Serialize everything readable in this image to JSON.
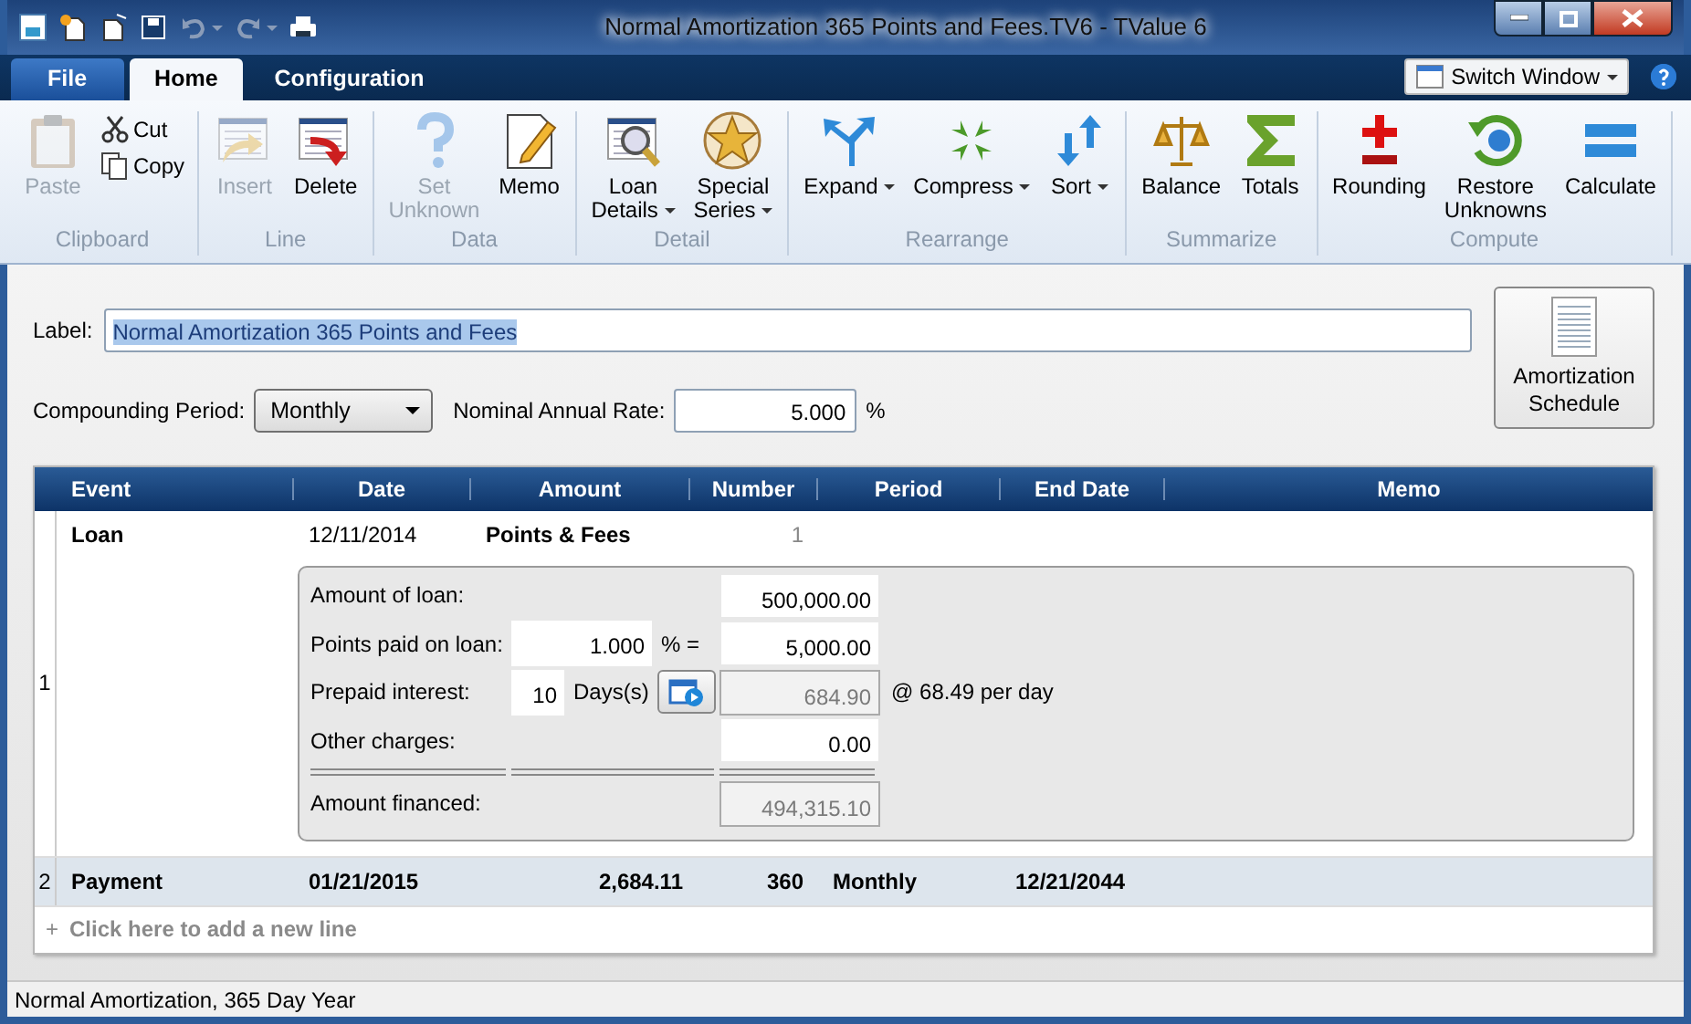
{
  "window": {
    "title": "Normal Amortization 365 Points and Fees.TV6 - TValue 6"
  },
  "menu_tabs": [
    {
      "label": "File",
      "kind": "application",
      "selected": false
    },
    {
      "label": "Home",
      "kind": "tab",
      "selected": true
    },
    {
      "label": "Configuration",
      "kind": "tab",
      "selected": false
    }
  ],
  "switch_window": {
    "label": "Switch Window"
  },
  "ribbon": [
    {
      "label": "Clipboard",
      "items": [
        {
          "label": "Paste",
          "kind": "large",
          "disabled": true,
          "dropdown": false
        },
        {
          "label": "Cut",
          "kind": "small",
          "disabled": false
        },
        {
          "label": "Copy",
          "kind": "small",
          "disabled": false
        }
      ]
    },
    {
      "label": "Line",
      "items": [
        {
          "label": "Insert",
          "kind": "large",
          "disabled": true,
          "dropdown": false
        },
        {
          "label": "Delete",
          "kind": "large",
          "disabled": false,
          "dropdown": false
        }
      ]
    },
    {
      "label": "Data",
      "items": [
        {
          "label": "Set Unknown",
          "kind": "large",
          "disabled": true,
          "dropdown": false
        },
        {
          "label": "Memo",
          "kind": "large",
          "disabled": false,
          "dropdown": false
        }
      ]
    },
    {
      "label": "Detail",
      "items": [
        {
          "label": "Loan Details",
          "kind": "large",
          "disabled": false,
          "dropdown": true
        },
        {
          "label": "Special Series",
          "kind": "large",
          "disabled": false,
          "dropdown": true
        }
      ]
    },
    {
      "label": "Rearrange",
      "items": [
        {
          "label": "Expand",
          "kind": "large",
          "disabled": false,
          "dropdown": true
        },
        {
          "label": "Compress",
          "kind": "large",
          "disabled": false,
          "dropdown": true
        },
        {
          "label": "Sort",
          "kind": "large",
          "disabled": false,
          "dropdown": true
        }
      ]
    },
    {
      "label": "Summarize",
      "items": [
        {
          "label": "Balance",
          "kind": "large",
          "disabled": false,
          "dropdown": false
        },
        {
          "label": "Totals",
          "kind": "large",
          "disabled": false,
          "dropdown": false
        }
      ]
    },
    {
      "label": "Compute",
      "items": [
        {
          "label": "Rounding",
          "kind": "large",
          "disabled": false,
          "dropdown": false
        },
        {
          "label": "Restore Unknowns",
          "kind": "large",
          "disabled": false,
          "dropdown": false
        },
        {
          "label": "Calculate",
          "kind": "large",
          "disabled": false,
          "dropdown": false
        }
      ]
    }
  ],
  "form": {
    "label_field": {
      "label": "Label:",
      "value": "Normal Amortization 365 Points and Fees",
      "text_selected": true
    },
    "compounding": {
      "label": "Compounding Period:",
      "value": "Monthly"
    },
    "rate": {
      "label": "Nominal Annual Rate:",
      "value": "5.000",
      "unit": "%"
    },
    "schedule_button": "Amortization Schedule"
  },
  "table": {
    "columns": [
      "Event",
      "Date",
      "Amount",
      "Number",
      "Period",
      "End Date",
      "Memo"
    ],
    "rows": [
      {
        "index": "1",
        "selected": false,
        "cells": [
          "Loan",
          "12/11/2014",
          "Points & Fees",
          "1",
          "",
          "",
          ""
        ],
        "details": [
          {
            "kind": "plain",
            "label": "Amount of loan:",
            "value": "500,000.00",
            "readonly": false
          },
          {
            "kind": "percent",
            "label": "Points paid on loan:",
            "rate": "1.000",
            "sign": "% =",
            "value": "5,000.00",
            "readonly": false
          },
          {
            "kind": "days",
            "label": "Prepaid interest:",
            "days": "10",
            "unit": "Days(s)",
            "value": "684.90",
            "readonly": true,
            "note": "@ 68.49 per day"
          },
          {
            "kind": "plain",
            "label": "Other charges:",
            "value": "0.00",
            "readonly": false
          },
          {
            "kind": "total",
            "label": "Amount financed:",
            "value": "494,315.10",
            "readonly": true
          }
        ]
      },
      {
        "index": "2",
        "selected": true,
        "cells": [
          "Payment",
          "01/21/2015",
          "2,684.11",
          "360",
          "Monthly",
          "12/21/2044",
          ""
        ]
      }
    ],
    "add_line": {
      "symbol": "+",
      "label": "Click here to add a new line"
    }
  },
  "status_bar": "Normal Amortization, 365 Day Year"
}
